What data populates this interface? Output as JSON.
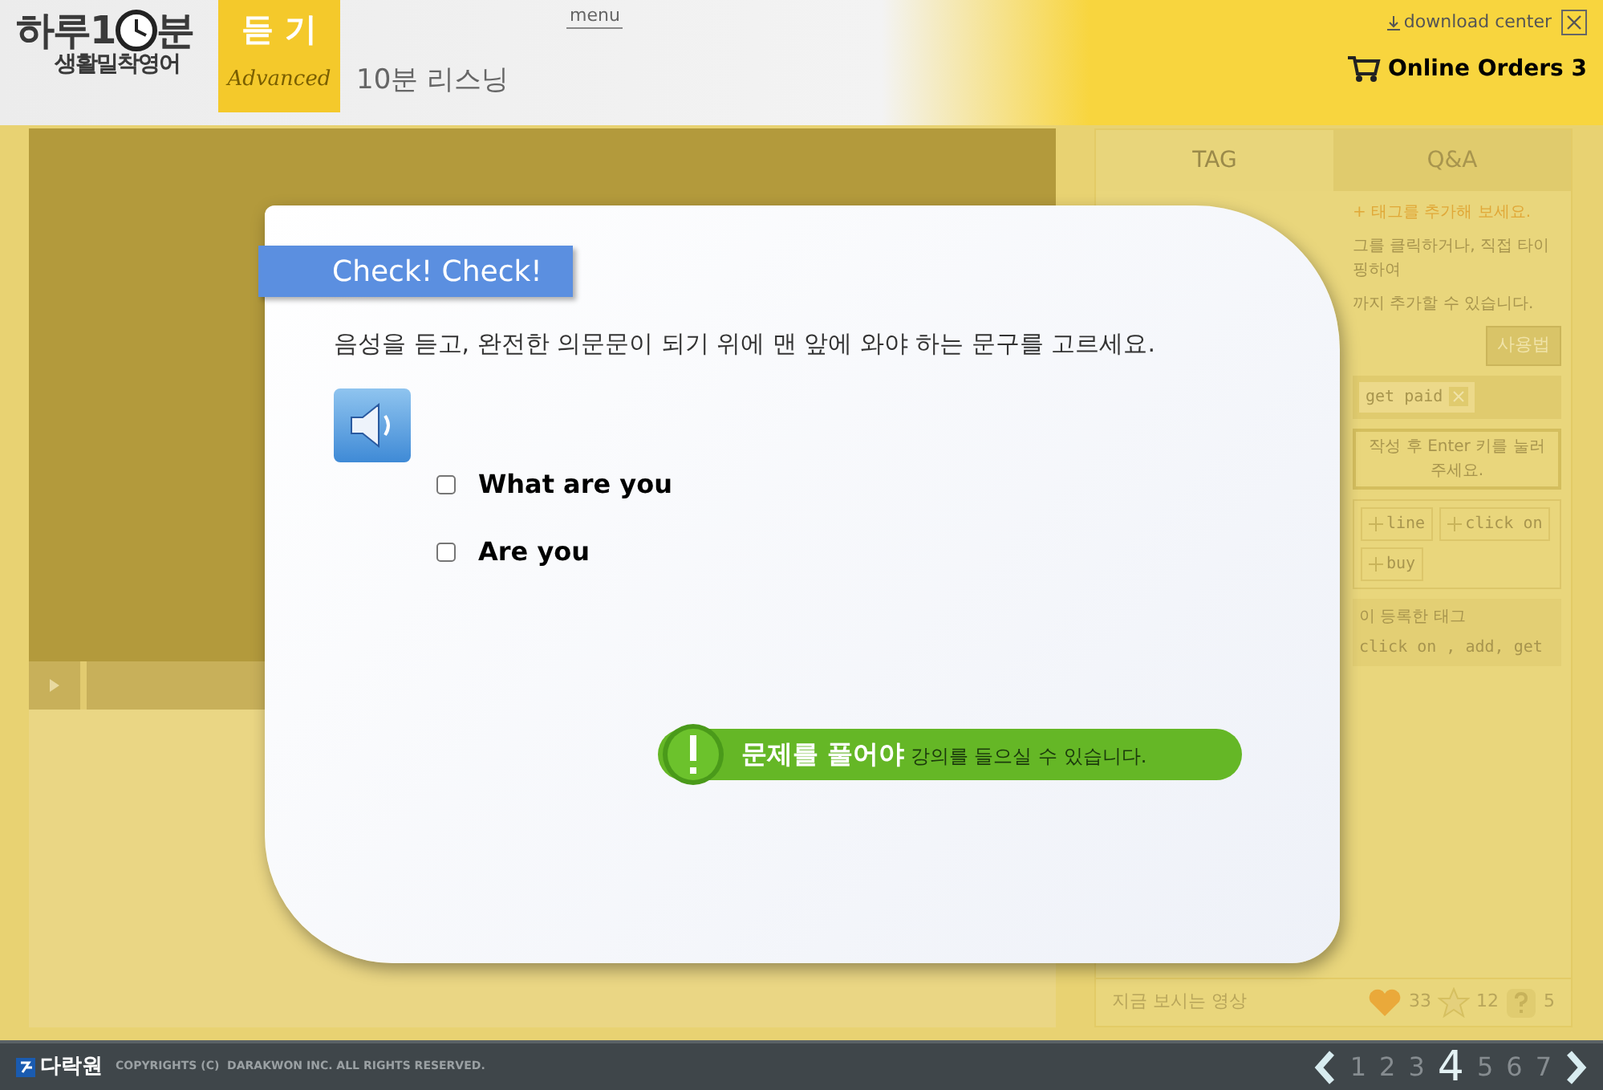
{
  "header": {
    "logo_top": [
      "하루1",
      "분"
    ],
    "logo_bottom": "생활밀착영어",
    "section_tab": {
      "label": "듣 기",
      "sub": "Advanced"
    },
    "subtitle": "10분 리스닝",
    "menu": "menu",
    "download": "download center",
    "orders": "Online Orders 3"
  },
  "side_panel": {
    "tabs": [
      {
        "label": "TAG",
        "selected": true
      },
      {
        "label": "Q&A",
        "selected": false
      }
    ],
    "hint": "+ 태그를 추가해 보세요.",
    "help_lines": [
      "그를 클릭하거나, 직접 타이핑하여",
      "까지 추가할 수 있습니다."
    ],
    "help_button": "사용법",
    "tags": [
      "get paid"
    ],
    "tooltip": "작성 후 Enter 키를 눌러 주세요.",
    "suggested": [
      "line",
      "click on",
      "buy"
    ],
    "registered_title": "이 등록한 태그",
    "registered_tags": "click on , add, get",
    "footer": {
      "label": "지금 보시는 영상",
      "likes": "33",
      "stars": "12",
      "questions": "5"
    }
  },
  "quiz": {
    "banner": "Check! Check!",
    "question": "음성을 듣고, 완전한 의문문이 되기 위에 맨 앞에 와야 하는 문구를 고르세요.",
    "options": [
      {
        "label": "What are you",
        "checked": false
      },
      {
        "label": "Are you",
        "checked": false
      }
    ],
    "notice_bold": "문제를 풀어야",
    "notice_rest": "강의를 들으실 수 있습니다."
  },
  "footer": {
    "brand": "다락원",
    "copyright": "COPYRIGHTS (C)  DARAKWON INC. ALL RIGHTS RESERVED.",
    "pages": [
      {
        "label": "1",
        "selected": false
      },
      {
        "label": "2",
        "selected": false
      },
      {
        "label": "3",
        "selected": false
      },
      {
        "label": "4",
        "selected": true
      },
      {
        "label": "5",
        "selected": false
      },
      {
        "label": "6",
        "selected": false
      },
      {
        "label": "7",
        "selected": false
      }
    ]
  }
}
